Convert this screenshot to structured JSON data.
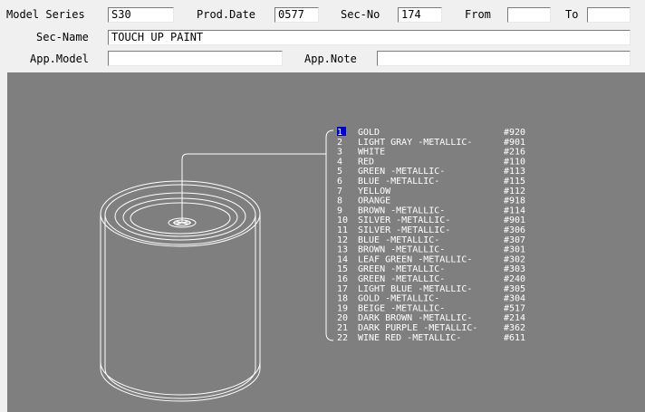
{
  "header": {
    "model_series_label": "Model Series",
    "model_series_value": "S30",
    "prod_date_label": "Prod.Date",
    "prod_date_value": "0577",
    "sec_no_label": "Sec-No",
    "sec_no_value": "174",
    "from_label": "From",
    "from_value": "",
    "to_label": "To",
    "to_value": "",
    "sec_name_label": "Sec-Name",
    "sec_name_value": "TOUCH UP PAINT",
    "app_model_label": "App.Model",
    "app_model_value": "",
    "app_note_label": "App.Note",
    "app_note_value": ""
  },
  "parts": [
    {
      "no": "1",
      "name": "GOLD",
      "code": "#920",
      "selected": true
    },
    {
      "no": "2",
      "name": "LIGHT GRAY -METALLIC-",
      "code": "#901"
    },
    {
      "no": "3",
      "name": "WHITE",
      "code": "#216"
    },
    {
      "no": "4",
      "name": "RED",
      "code": "#110"
    },
    {
      "no": "5",
      "name": "GREEN -METALLIC-",
      "code": "#113"
    },
    {
      "no": "6",
      "name": "BLUE -METALLIC-",
      "code": "#115"
    },
    {
      "no": "7",
      "name": "YELLOW",
      "code": "#112"
    },
    {
      "no": "8",
      "name": "ORANGE",
      "code": "#918"
    },
    {
      "no": "9",
      "name": "BROWN -METALLIC-",
      "code": "#114"
    },
    {
      "no": "10",
      "name": "SILVER -METALLIC-",
      "code": "#901"
    },
    {
      "no": "11",
      "name": "SILVER -METALLIC-",
      "code": "#306"
    },
    {
      "no": "12",
      "name": "BLUE -METALLIC-",
      "code": "#307"
    },
    {
      "no": "13",
      "name": "BROWN -METALLIC-",
      "code": "#301"
    },
    {
      "no": "14",
      "name": "LEAF GREEN -METALLIC-",
      "code": "#302"
    },
    {
      "no": "15",
      "name": "GREEN -METALLIC-",
      "code": "#303"
    },
    {
      "no": "16",
      "name": "GREEN -METALLIC-",
      "code": "#240"
    },
    {
      "no": "17",
      "name": "LIGHT BLUE -METALLIC-",
      "code": "#305"
    },
    {
      "no": "18",
      "name": "GOLD -METALLIC-",
      "code": "#304"
    },
    {
      "no": "19",
      "name": "BEIGE -METALLIC-",
      "code": "#517"
    },
    {
      "no": "20",
      "name": "DARK BROWN -METALLIC-",
      "code": "#214"
    },
    {
      "no": "21",
      "name": "DARK PURPLE -METALLIC-",
      "code": "#362"
    },
    {
      "no": "22",
      "name": "WINE RED -METALLIC-",
      "code": "#611"
    }
  ],
  "colors": {
    "drawing_bg": "#7f7f7f",
    "line": "#ffffff",
    "selected_bg": "#0000cc"
  }
}
